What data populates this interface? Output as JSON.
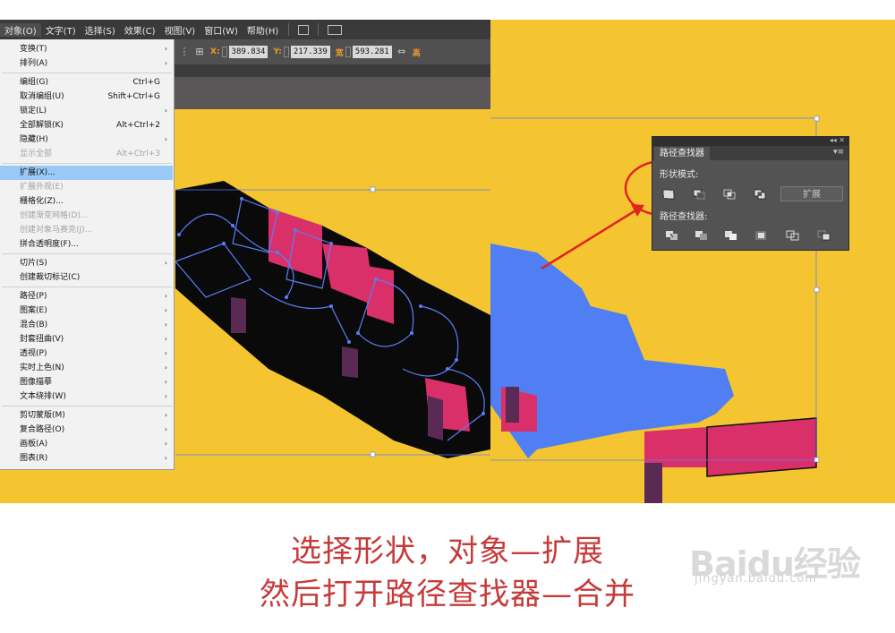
{
  "menubar": {
    "items": [
      "对象(O)",
      "文字(T)",
      "选择(S)",
      "效果(C)",
      "视图(V)",
      "窗口(W)",
      "帮助(H)"
    ]
  },
  "controlbar": {
    "x_label": "X:",
    "x_value": "389.834",
    "y_label": "Y:",
    "y_value": "217.339",
    "w_label": "宽",
    "w_value": "593.281"
  },
  "menu": {
    "items": [
      {
        "label": "变换(T)",
        "shortcut": "",
        "submenu": true,
        "disabled": false
      },
      {
        "label": "排列(A)",
        "shortcut": "",
        "submenu": true,
        "disabled": false
      },
      {
        "label": "编组(G)",
        "shortcut": "Ctrl+G",
        "submenu": false,
        "disabled": false
      },
      {
        "label": "取消编组(U)",
        "shortcut": "Shift+Ctrl+G",
        "submenu": false,
        "disabled": false
      },
      {
        "label": "锁定(L)",
        "shortcut": "",
        "submenu": true,
        "disabled": false
      },
      {
        "label": "全部解锁(K)",
        "shortcut": "Alt+Ctrl+2",
        "submenu": false,
        "disabled": false
      },
      {
        "label": "隐藏(H)",
        "shortcut": "",
        "submenu": true,
        "disabled": false
      },
      {
        "label": "显示全部",
        "shortcut": "Alt+Ctrl+3",
        "submenu": false,
        "disabled": true
      },
      {
        "label": "扩展(X)...",
        "shortcut": "",
        "submenu": false,
        "disabled": false,
        "highlighted": true
      },
      {
        "label": "扩展外观(E)",
        "shortcut": "",
        "submenu": false,
        "disabled": true
      },
      {
        "label": "栅格化(Z)...",
        "shortcut": "",
        "submenu": false,
        "disabled": false
      },
      {
        "label": "创建渐变网格(D)...",
        "shortcut": "",
        "submenu": false,
        "disabled": true
      },
      {
        "label": "创建对象马赛克(J)...",
        "shortcut": "",
        "submenu": false,
        "disabled": true
      },
      {
        "label": "拼合透明度(F)...",
        "shortcut": "",
        "submenu": false,
        "disabled": false
      },
      {
        "label": "切片(S)",
        "shortcut": "",
        "submenu": true,
        "disabled": false
      },
      {
        "label": "创建裁切标记(C)",
        "shortcut": "",
        "submenu": false,
        "disabled": false
      },
      {
        "label": "路径(P)",
        "shortcut": "",
        "submenu": true,
        "disabled": false
      },
      {
        "label": "图案(E)",
        "shortcut": "",
        "submenu": true,
        "disabled": false
      },
      {
        "label": "混合(B)",
        "shortcut": "",
        "submenu": true,
        "disabled": false
      },
      {
        "label": "封套扭曲(V)",
        "shortcut": "",
        "submenu": true,
        "disabled": false
      },
      {
        "label": "透视(P)",
        "shortcut": "",
        "submenu": true,
        "disabled": false
      },
      {
        "label": "实时上色(N)",
        "shortcut": "",
        "submenu": true,
        "disabled": false
      },
      {
        "label": "图像描摹",
        "shortcut": "",
        "submenu": true,
        "disabled": false
      },
      {
        "label": "文本绕排(W)",
        "shortcut": "",
        "submenu": true,
        "disabled": false
      },
      {
        "label": "剪切蒙版(M)",
        "shortcut": "",
        "submenu": true,
        "disabled": false
      },
      {
        "label": "复合路径(O)",
        "shortcut": "",
        "submenu": true,
        "disabled": false
      },
      {
        "label": "画板(A)",
        "shortcut": "",
        "submenu": true,
        "disabled": false
      },
      {
        "label": "图表(R)",
        "shortcut": "",
        "submenu": true,
        "disabled": false
      }
    ]
  },
  "pathfinder": {
    "tab": "路径查找器",
    "shape_modes": "形状模式:",
    "pathfinders": "路径查找器:",
    "expand": "扩展"
  },
  "caption": {
    "line1": "选择形状，对象—扩展",
    "line2": "然后打开路径查找器—合并"
  },
  "watermark": {
    "brand": "Baidu经验",
    "url": "jingyan.baidu.com"
  },
  "colors": {
    "canvas": "#f4c530",
    "shape_blue": "#4f7ff2",
    "shape_pink": "#d9306a",
    "annotation_red": "#e0231f",
    "caption_red": "#c63a3a"
  }
}
